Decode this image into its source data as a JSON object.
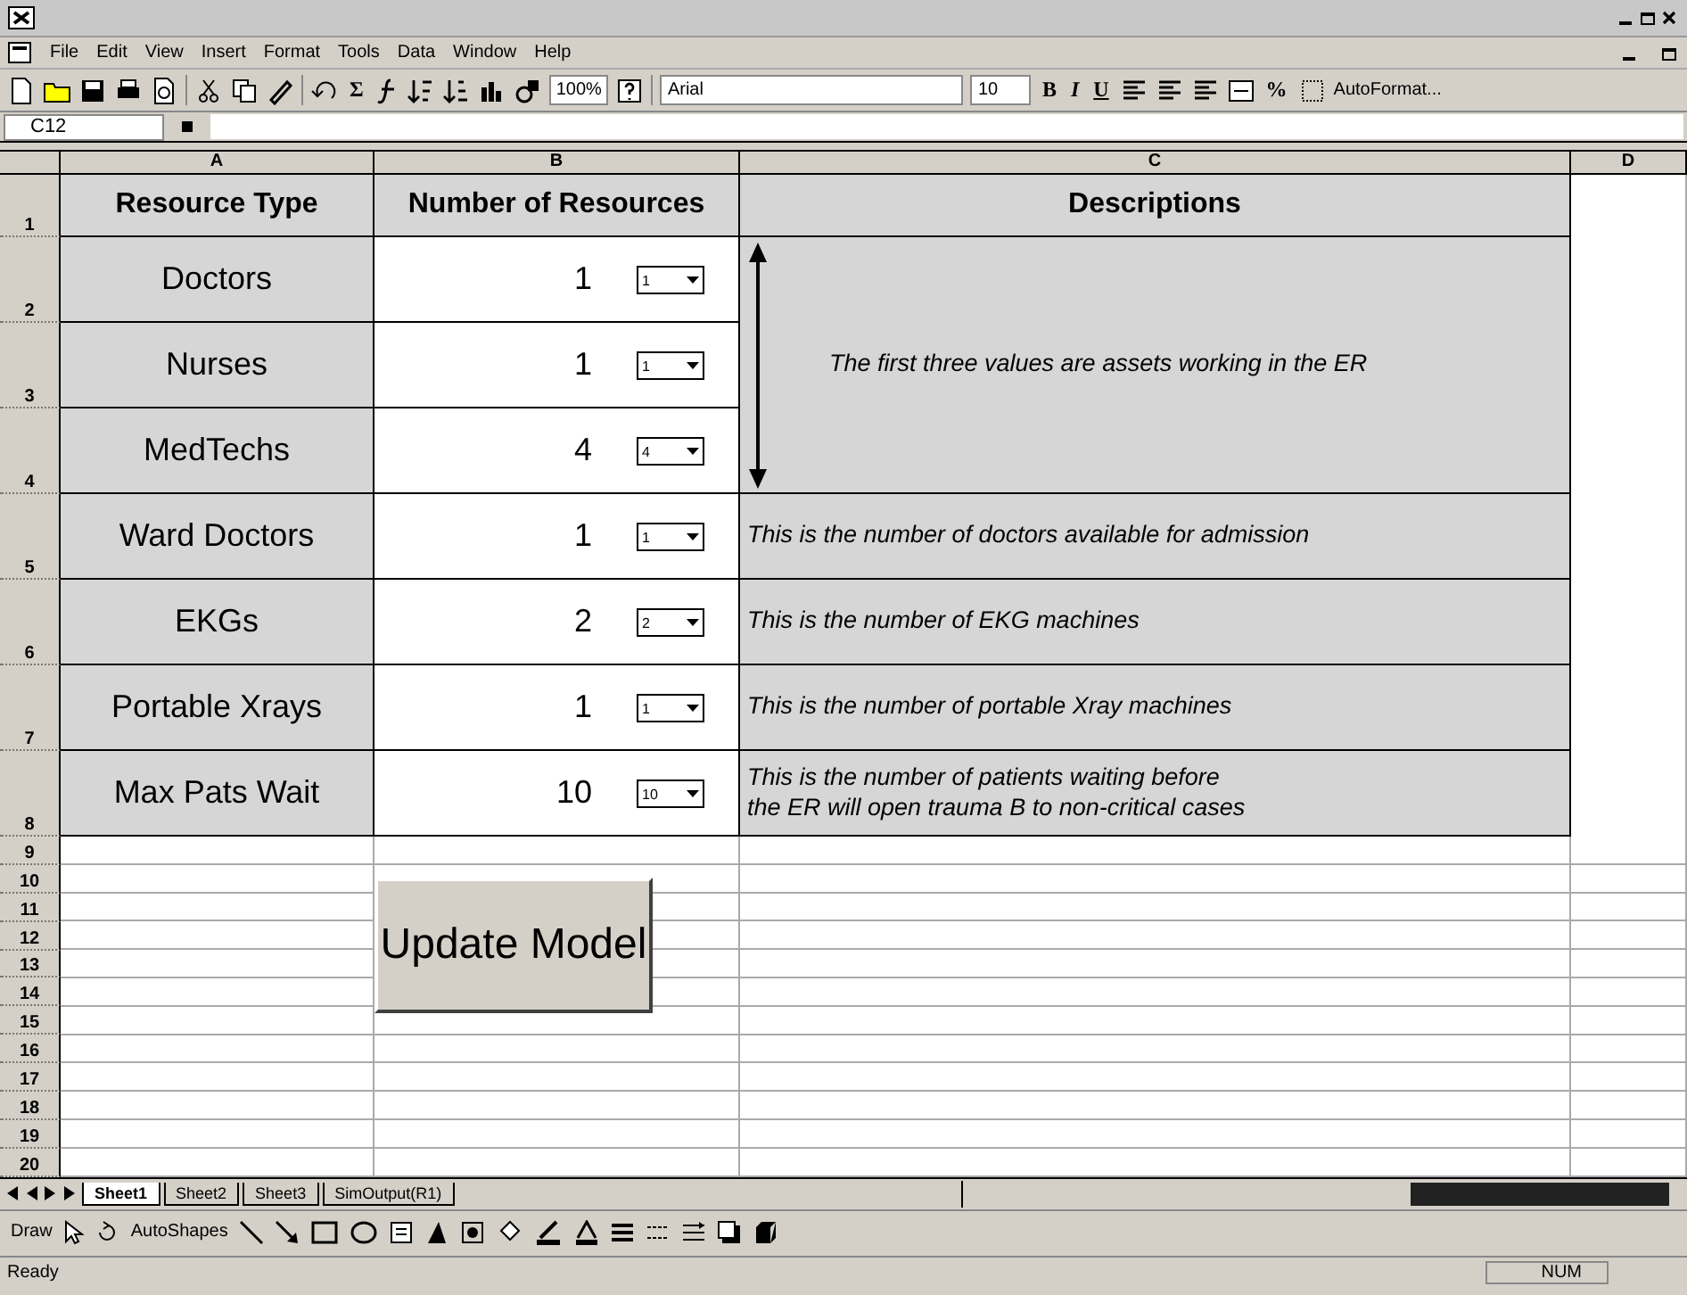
{
  "menu": [
    "File",
    "Edit",
    "View",
    "Insert",
    "Format",
    "Tools",
    "Data",
    "Window",
    "Help"
  ],
  "toolbar": {
    "sum": "Σ",
    "zoom": "100%",
    "font": "Arial",
    "size": "10",
    "bold": "B",
    "italic": "I",
    "underline": "U",
    "percent": "%",
    "autoformat": "AutoFormat..."
  },
  "formula_bar": {
    "name_box": "C12"
  },
  "columns": [
    "A",
    "B",
    "C",
    "D"
  ],
  "rows": [
    "1",
    "2",
    "3",
    "4",
    "5",
    "6",
    "7",
    "8",
    "9",
    "10",
    "11",
    "12",
    "13",
    "14",
    "15",
    "16",
    "17",
    "18",
    "19",
    "20"
  ],
  "headers": [
    "Resource Type",
    "Number of Resources",
    "Descriptions"
  ],
  "resources": [
    {
      "type": "Doctors",
      "count": "1",
      "choice": "1"
    },
    {
      "type": "Nurses",
      "count": "1",
      "choice": "1"
    },
    {
      "type": "MedTechs",
      "count": "4",
      "choice": "4"
    },
    {
      "type": "Ward Doctors",
      "count": "1",
      "choice": "1"
    },
    {
      "type": "EKGs",
      "count": "2",
      "choice": "2"
    },
    {
      "type": "Portable Xrays",
      "count": "1",
      "choice": "1"
    },
    {
      "type": "Max Pats Wait",
      "count": "10",
      "choice": "10"
    }
  ],
  "descriptions": [
    {
      "kind": "group",
      "text": "The first three values are assets working in the ER"
    },
    {
      "kind": "single",
      "text": "This is the number of doctors available for admission"
    },
    {
      "kind": "single",
      "text": "This is the number of EKG machines"
    },
    {
      "kind": "single",
      "text": "This is the number of portable Xray machines"
    },
    {
      "kind": "single",
      "text": "This is the number of patients waiting before\nthe ER will open trauma B to non-critical cases"
    }
  ],
  "update_button": "Update Model",
  "sheet_tabs": [
    {
      "label": "Sheet1",
      "selected": true
    },
    {
      "label": "Sheet2",
      "selected": false
    },
    {
      "label": "Sheet3",
      "selected": false
    },
    {
      "label": "SimOutput(R1)",
      "selected": false
    }
  ],
  "drawing_toolbar": {
    "draw": "Draw",
    "autoshapes": "AutoShapes"
  },
  "status_bar": {
    "status": "Ready",
    "num": "NUM"
  }
}
